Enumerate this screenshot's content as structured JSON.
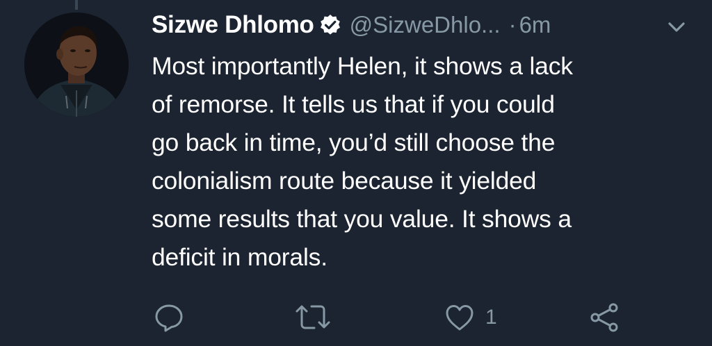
{
  "tweet": {
    "author": {
      "display_name": "Sizwe Dhlomo",
      "verified": true,
      "handle": "@SizweDhlo...",
      "avatar_icon": "profile-photo"
    },
    "separator": "·",
    "timestamp": "6m",
    "menu_icon": "chevron-down-icon",
    "body_lines": [
      "Most importantly Helen, it shows a lack",
      "of remorse. It tells us that if you could",
      "go back in time, you’d still choose the",
      "colonialism route because it yielded",
      "some results that you value. It shows a",
      "deficit in morals."
    ],
    "actions": {
      "reply_icon": "reply-icon",
      "retweet_icon": "retweet-icon",
      "like_icon": "heart-icon",
      "like_count": "1",
      "share_icon": "share-icon"
    }
  },
  "colors": {
    "background": "#1b2430",
    "text_primary": "#ffffff",
    "text_secondary": "#8899a6"
  }
}
